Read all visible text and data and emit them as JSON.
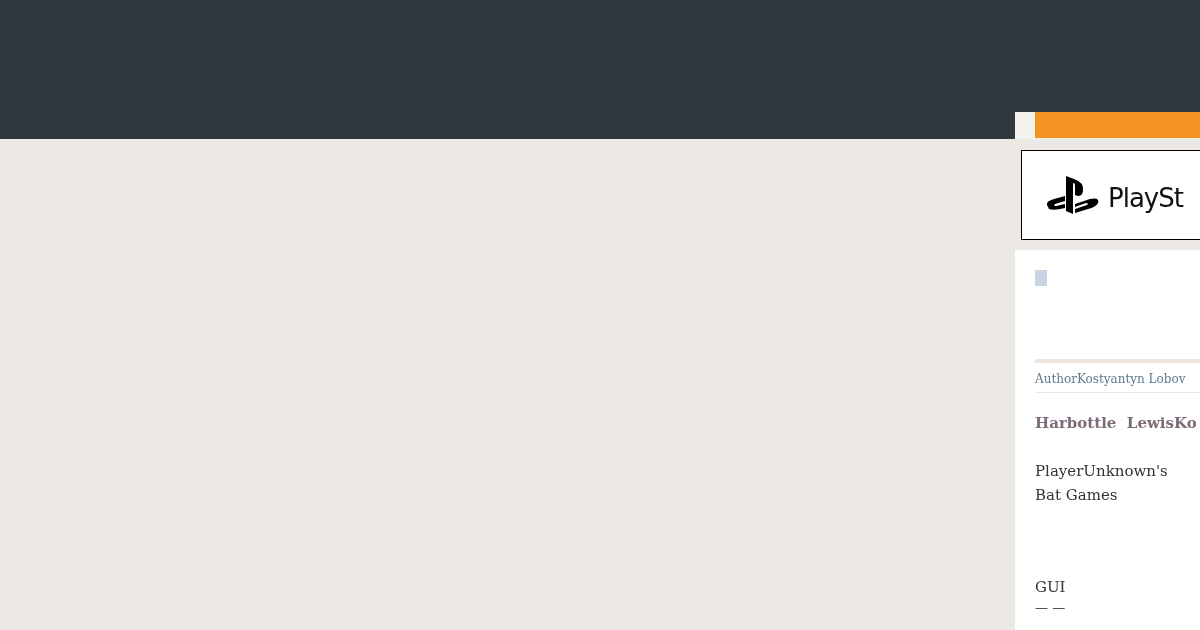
{
  "logo": {
    "text": "PlaySt"
  },
  "author": {
    "label": "Author",
    "name": "Kostyantyn Lobov"
  },
  "byline": "Harbottle  LewisKo",
  "game_title": "PlayerUnknown's Bat Games",
  "section": "GUI",
  "dashes": "— —"
}
